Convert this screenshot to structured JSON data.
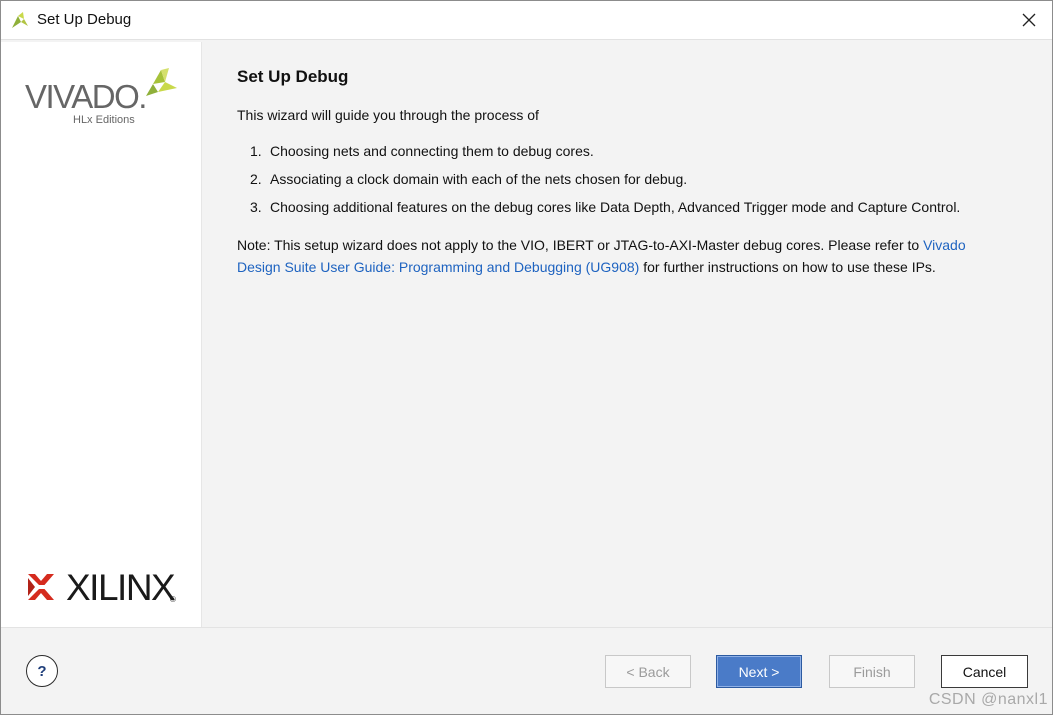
{
  "window": {
    "title": "Set Up Debug",
    "close_icon": "close-icon",
    "app_icon": "vivado-app-icon"
  },
  "sidebar": {
    "top_logo": {
      "word": "VIVADO",
      "dot": ".",
      "sub": "HLx Editions"
    },
    "bottom_logo": {
      "word": "XILINX",
      "reg": "®"
    }
  },
  "content": {
    "heading": "Set Up Debug",
    "intro": "This wizard will guide you through the process of",
    "steps": [
      {
        "num": "1.",
        "text": "Choosing nets and connecting them to debug cores."
      },
      {
        "num": "2.",
        "text": "Associating a clock domain with each of the nets chosen for debug."
      },
      {
        "num": "3.",
        "text": "Choosing additional features on the debug cores like Data Depth, Advanced Trigger mode and Capture Control."
      }
    ],
    "note_prefix": "Note: This setup wizard does not apply to the VIO, IBERT or JTAG-to-AXI-Master debug cores. Please refer to ",
    "note_link": "Vivado Design Suite User Guide: Programming and Debugging (UG908)",
    "note_suffix": " for further instructions on how to use these IPs."
  },
  "footer": {
    "help_label": "?",
    "back_label": "< Back",
    "next_label": "Next >",
    "finish_label": "Finish",
    "cancel_label": "Cancel"
  },
  "watermark": "CSDN @nanxl1",
  "colors": {
    "accent": "#4a7bc8",
    "link": "#1e63c0",
    "vivado_green": "#a6c23a",
    "xilinx_red": "#d52b1e"
  }
}
